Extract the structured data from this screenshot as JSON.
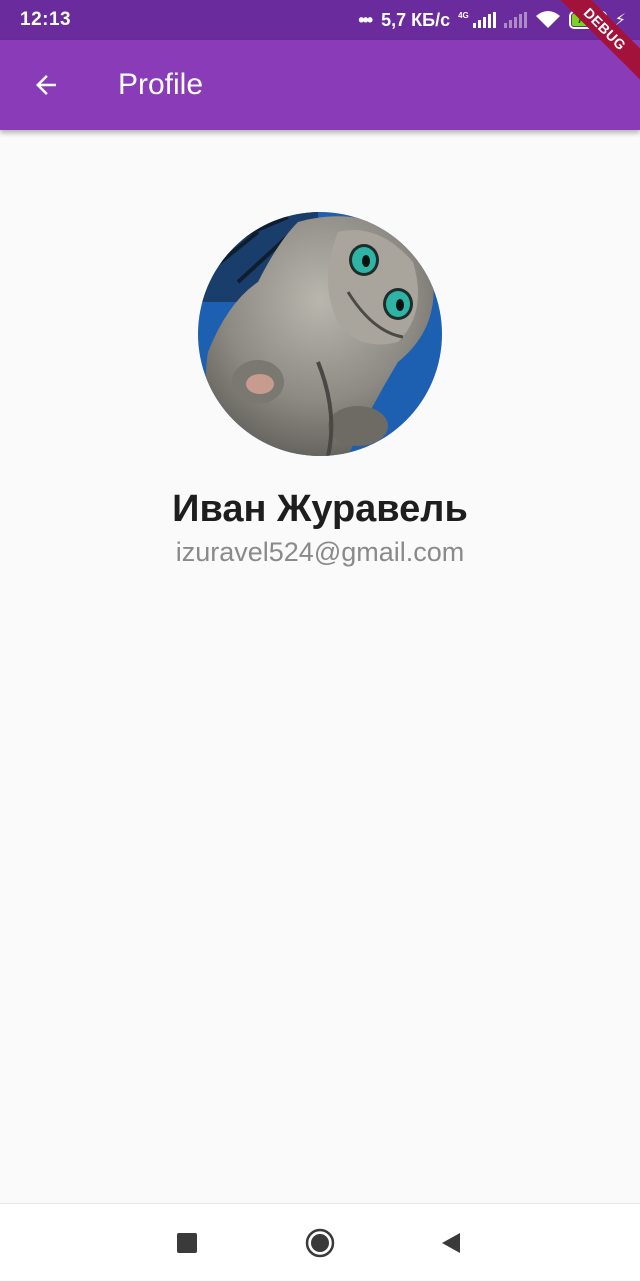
{
  "status_bar": {
    "time": "12:13",
    "dots": "•••",
    "speed": "5,7 КБ/с",
    "network_tag": "4G",
    "battery_level": "71",
    "icons": [
      "signal-icon",
      "wifi-icon",
      "battery-icon",
      "charging-icon"
    ]
  },
  "debug_banner": "DEBUG",
  "app_bar": {
    "title": "Profile",
    "back_icon": "arrow-back-icon",
    "color": "#8a3bb8"
  },
  "profile": {
    "avatar_icon": "avatar-cat-photo",
    "name": "Иван Журавель",
    "email": "izuravel524@gmail.com"
  },
  "nav_bar": {
    "icons": [
      "recents-icon",
      "home-icon",
      "back-icon"
    ]
  }
}
